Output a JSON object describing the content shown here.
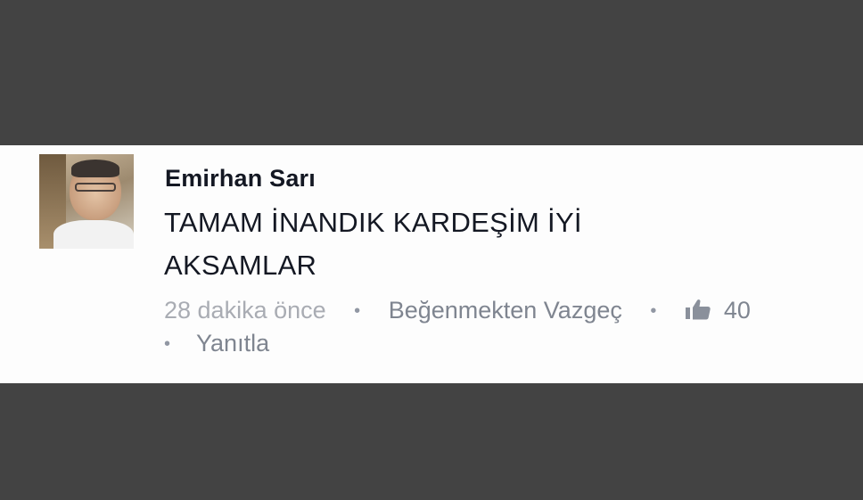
{
  "comment": {
    "author": "Emirhan Sarı",
    "text_line1": "TAMAM İNANDIK KARDEŞİM İYİ",
    "text_line2": "AKSAMLAR",
    "timestamp": "28 dakika önce",
    "separator": "•",
    "unlike_label": "Beğenmekten Vazgeç",
    "like_icon": "thumbs-up-icon",
    "like_count": "40",
    "reply_label": "Yanıtla"
  }
}
